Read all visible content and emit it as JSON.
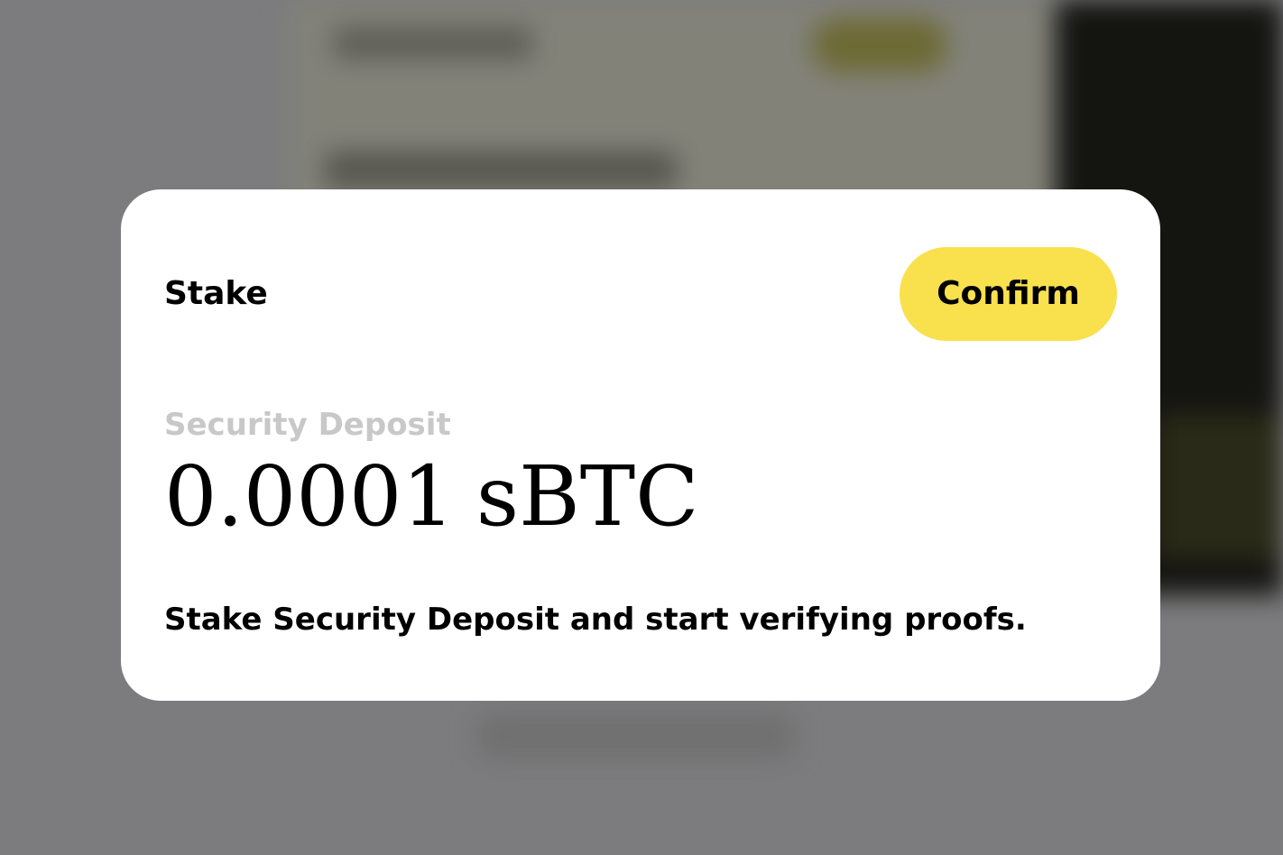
{
  "modal": {
    "title": "Stake",
    "confirm_label": "Confirm",
    "deposit_label": "Security Deposit",
    "deposit_value": "0.0001",
    "deposit_unit": "sBTC",
    "description": "Stake Security Deposit and start verifying proofs."
  },
  "colors": {
    "confirm_button": "#f9e04d",
    "overlay": "#7c7c7e",
    "label_muted": "#c8c8c8"
  }
}
